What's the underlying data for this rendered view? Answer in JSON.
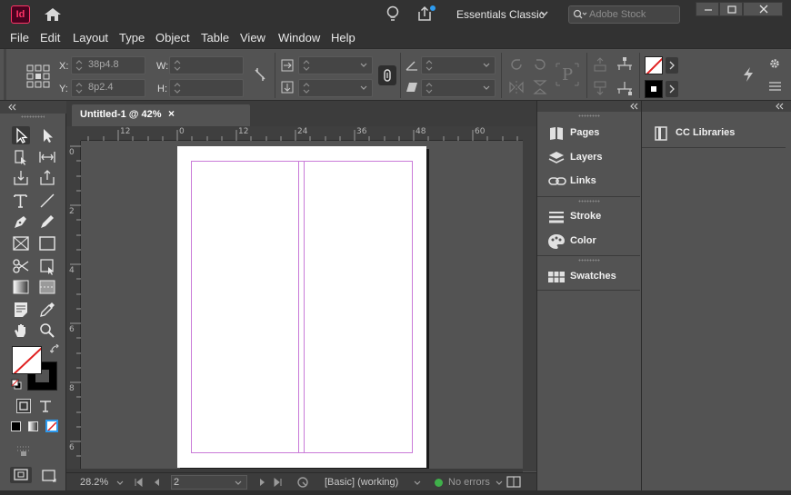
{
  "app": {
    "logo_text": "Id",
    "workspace": "Essentials Classic",
    "search_placeholder": "Adobe Stock"
  },
  "menu": [
    "File",
    "Edit",
    "Layout",
    "Type",
    "Object",
    "Table",
    "View",
    "Window",
    "Help"
  ],
  "control": {
    "x_label": "X:",
    "x_value": "38p4.8",
    "y_label": "Y:",
    "y_value": "8p2.4",
    "w_label": "W:",
    "w_value": "",
    "h_label": "H:",
    "h_value": ""
  },
  "tab": {
    "title": "Untitled-1 @ 42%",
    "close": "×"
  },
  "ruler_h": [
    "12",
    "0",
    "12",
    "24",
    "36",
    "48",
    "60"
  ],
  "ruler_v": [
    "0",
    "2",
    "4",
    "6",
    "8",
    "6"
  ],
  "status": {
    "zoom": "28.2%",
    "page": "2",
    "style": "[Basic] (working)",
    "preflight": "No errors"
  },
  "panels": {
    "group1": [
      "Pages",
      "Layers",
      "Links"
    ],
    "group2": [
      "Stroke",
      "Color"
    ],
    "group3": [
      "Swatches"
    ],
    "libraries": "CC Libraries"
  },
  "colors": {
    "accent_id": "#ff3366",
    "margin_guide": "#c97ad8",
    "preflight_ok": "#3fb04a",
    "badge": "#2d9bf0"
  }
}
